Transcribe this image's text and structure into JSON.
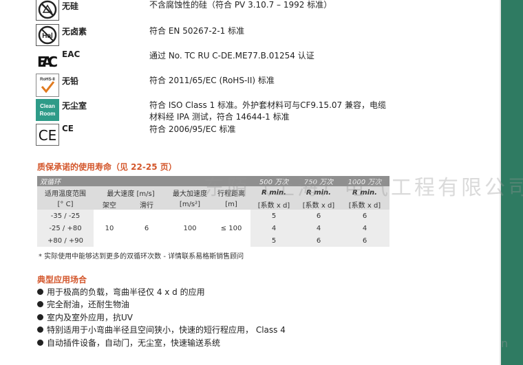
{
  "properties": [
    {
      "name": "无硅",
      "desc": "不含腐蚀性的硅（符合 PV 3.10.7 – 1992 标准）",
      "icon": "no-silicone-icon"
    },
    {
      "name": "无卤素",
      "desc": "符合 EN 50267-2-1 标准",
      "icon": "halogen-free-icon",
      "icon_text": "Hal"
    },
    {
      "name": "EAC",
      "desc": "通过 No. TC RU C-DE.ME77.B.01254 认证",
      "icon": "eac-icon",
      "icon_text": "EAC"
    },
    {
      "name": "无铅",
      "desc": "符合 2011/65/EC (RoHS-II) 标准",
      "icon": "rohs-icon",
      "icon_text": "RoHS-II"
    },
    {
      "name": "无尘室",
      "desc": "符合 ISO Class 1 标准。外护套材料可与CF9.15.07 兼容，电缆",
      "desc2": "材料经 IPA 测试，符合 14644-1 标准",
      "icon": "clean-room-icon",
      "icon_text1": "Clean",
      "icon_text2": "Room"
    },
    {
      "name": "CE",
      "desc": "符合 2006/95/EC 标准",
      "icon": "ce-icon",
      "icon_text": "CE"
    }
  ],
  "service_life": {
    "title": "质保承诺的使用寿命（见 22-25 页）",
    "band_left": "双循环",
    "band_cycles": [
      "500 万次",
      "750 万次",
      "1000 万次"
    ],
    "headers": {
      "temp": "适用温度范围",
      "temp_unit": "[° C]",
      "max_speed": "最大速度 [m/s]",
      "unsupported": "架空",
      "gliding": "滑行",
      "max_accel": "最大加速度",
      "accel_unit": "[m/s²]",
      "travel": "行程距离",
      "travel_unit": "[m]",
      "rmin": "R min.",
      "rmin_unit": "[系数 x d]"
    },
    "rows": [
      {
        "temp": "-35 / -25",
        "r": [
          "5",
          "6",
          "6"
        ]
      },
      {
        "temp": "-25 / +80",
        "r": [
          "4",
          "4",
          "4"
        ]
      },
      {
        "temp": "+80 / +90",
        "r": [
          "5",
          "6",
          "6"
        ]
      }
    ],
    "shared": {
      "unsupported": "10",
      "gliding": "6",
      "accel": "100",
      "travel": "≤ 100"
    },
    "note": "* 实际使用中能够达到更多的双循环次数 - 详情联系易格斯销售顾问"
  },
  "applications": {
    "title": "典型应用场合",
    "items": [
      "用于极高的负载，弯曲半径仅 4 x d 的应用",
      "完全耐油，还耐生物油",
      "室内及室外应用，抗UV",
      "特别适用于小弯曲半径且空间狭小，快速的短行程应用， Class 4",
      "自动插件设备，自动门，无尘室，快速输送系统"
    ]
  },
  "watermark": "东陌（上海）电气工程有限公司",
  "watermark_tail": "n",
  "colors": {
    "accent": "#d3562b",
    "rail": "#2f7b62",
    "table_band": "#8f8f8f"
  }
}
